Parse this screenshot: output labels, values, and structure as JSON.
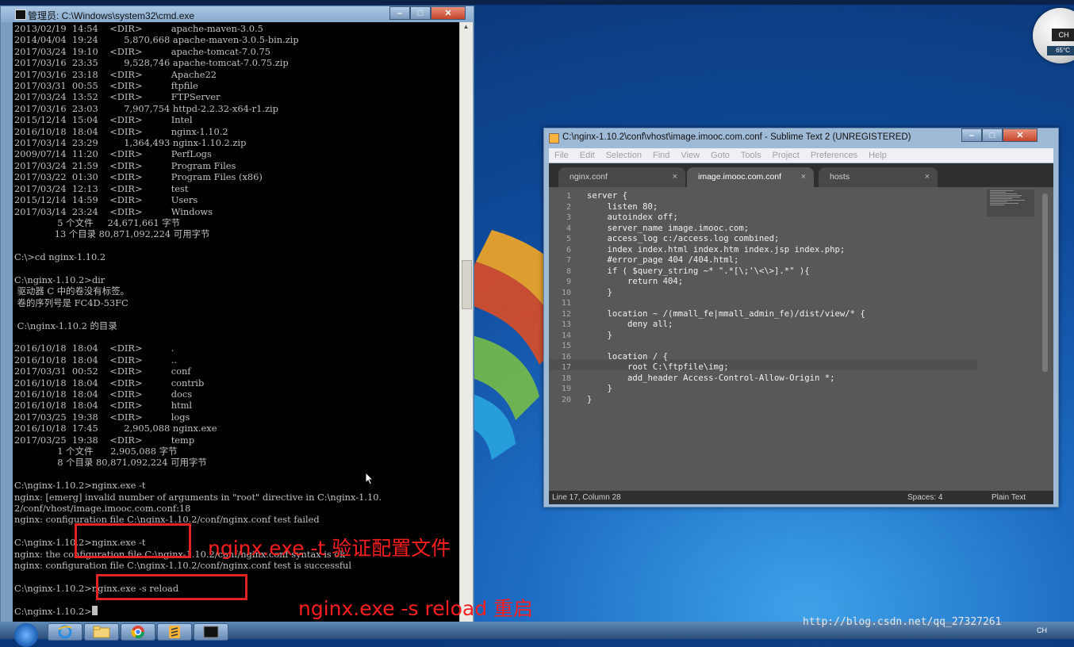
{
  "cmd": {
    "title": "管理员: C:\\Windows\\system32\\cmd.exe",
    "lines": [
      "2013/02/19  14:54    <DIR>          apache-maven-3.0.5",
      "2014/04/04  19:24         5,870,668 apache-maven-3.0.5-bin.zip",
      "2017/03/24  19:10    <DIR>          apache-tomcat-7.0.75",
      "2017/03/16  23:35         9,528,746 apache-tomcat-7.0.75.zip",
      "2017/03/16  23:18    <DIR>          Apache22",
      "2017/03/31  00:55    <DIR>          ftpfile",
      "2017/03/24  13:52    <DIR>          FTPServer",
      "2017/03/16  23:03         7,907,754 httpd-2.2.32-x64-r1.zip",
      "2015/12/14  15:04    <DIR>          Intel",
      "2016/10/18  18:04    <DIR>          nginx-1.10.2",
      "2017/03/14  23:29         1,364,493 nginx-1.10.2.zip",
      "2009/07/14  11:20    <DIR>          PerfLogs",
      "2017/03/24  21:59    <DIR>          Program Files",
      "2017/03/22  01:30    <DIR>          Program Files (x86)",
      "2017/03/24  12:13    <DIR>          test",
      "2015/12/14  14:59    <DIR>          Users",
      "2017/03/14  23:24    <DIR>          Windows",
      "               5 个文件     24,671,661 字节",
      "              13 个目录 80,871,092,224 可用字节",
      "",
      "C:\\>cd nginx-1.10.2",
      "",
      "C:\\nginx-1.10.2>dir",
      " 驱动器 C 中的卷没有标签。",
      " 卷的序列号是 FC4D-53FC",
      "",
      " C:\\nginx-1.10.2 的目录",
      "",
      "2016/10/18  18:04    <DIR>          .",
      "2016/10/18  18:04    <DIR>          ..",
      "2017/03/31  00:52    <DIR>          conf",
      "2016/10/18  18:04    <DIR>          contrib",
      "2016/10/18  18:04    <DIR>          docs",
      "2016/10/18  18:04    <DIR>          html",
      "2017/03/25  19:38    <DIR>          logs",
      "2016/10/18  17:45         2,905,088 nginx.exe",
      "2017/03/25  19:38    <DIR>          temp",
      "               1 个文件      2,905,088 字节",
      "               8 个目录 80,871,092,224 可用字节",
      "",
      "C:\\nginx-1.10.2>nginx.exe -t",
      "nginx: [emerg] invalid number of arguments in \"root\" directive in C:\\nginx-1.10.",
      "2/conf/vhost/image.imooc.com.conf:18",
      "nginx: configuration file C:\\nginx-1.10.2/conf/nginx.conf test failed",
      "",
      "C:\\nginx-1.10.2>nginx.exe -t",
      "nginx: the configuration file C:\\nginx-1.10.2/conf/nginx.conf syntax is ok",
      "nginx: configuration file C:\\nginx-1.10.2/conf/nginx.conf test is successful",
      "",
      "C:\\nginx-1.10.2>nginx.exe -s reload",
      "",
      "C:\\nginx-1.10.2>"
    ]
  },
  "annotations": {
    "test_label": "nginx.exe -t 验证配置文件",
    "reload_label": "nginx.exe -s reload  重启"
  },
  "sublime": {
    "title": "C:\\nginx-1.10.2\\conf\\vhost\\image.imooc.com.conf - Sublime Text 2 (UNREGISTERED)",
    "menu": [
      "File",
      "Edit",
      "Selection",
      "Find",
      "View",
      "Goto",
      "Tools",
      "Project",
      "Preferences",
      "Help"
    ],
    "tabs": [
      {
        "label": "nginx.conf",
        "close": "×"
      },
      {
        "label": "image.imooc.com.conf",
        "close": "×"
      },
      {
        "label": "hosts",
        "close": "×"
      }
    ],
    "code": [
      "server {",
      "    listen 80;",
      "    autoindex off;",
      "    server_name image.imooc.com;",
      "    access_log c:/access.log combined;",
      "    index index.html index.htm index.jsp index.php;",
      "    #error_page 404 /404.html;",
      "    if ( $query_string ~* \".*[\\;'\\<\\>].*\" ){",
      "        return 404;",
      "    }",
      "",
      "    location ~ /(mmall_fe|mmall_admin_fe)/dist/view/* {",
      "        deny all;",
      "    }",
      "",
      "    location / {",
      "        root C:\\ftpfile\\img;",
      "        add_header Access-Control-Allow-Origin *;",
      "    }",
      "}"
    ],
    "status": {
      "position": "Line 17, Column 28",
      "spaces": "Spaces: 4",
      "syntax": "Plain Text"
    }
  },
  "gadget": {
    "lang": "CH",
    "temp": "65°C"
  },
  "taskbar": {
    "lang": "CH"
  },
  "watermark": "http://blog.csdn.net/qq_27327261"
}
